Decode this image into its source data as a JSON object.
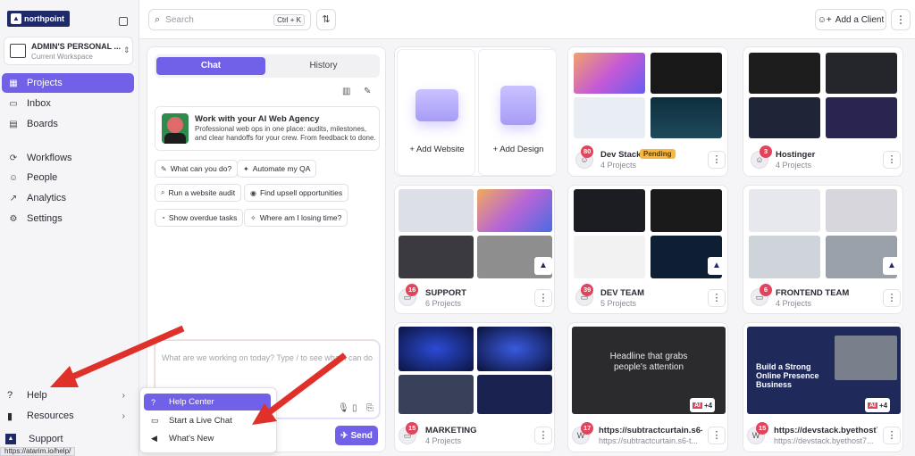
{
  "sidebar": {
    "logo_text": "northpoint",
    "workspace_name": "ADMIN'S PERSONAL ...",
    "workspace_sub": "Current Workspace",
    "nav": [
      {
        "label": "Projects",
        "icon": "grid-icon"
      },
      {
        "label": "Inbox",
        "icon": "inbox-icon"
      },
      {
        "label": "Boards",
        "icon": "board-icon"
      },
      {
        "label": "Workflows",
        "icon": "workflow-icon"
      },
      {
        "label": "People",
        "icon": "person-icon"
      },
      {
        "label": "Analytics",
        "icon": "chart-icon"
      },
      {
        "label": "Settings",
        "icon": "gear-icon"
      }
    ],
    "help_label": "Help",
    "resources_label": "Resources",
    "support_label": "Support",
    "status_url": "https://atarim.io/help/"
  },
  "topbar": {
    "search_placeholder": "Search",
    "search_shortcut": "Ctrl + K",
    "add_client_label": "Add a Client"
  },
  "chat": {
    "tabs": [
      "Chat",
      "History"
    ],
    "agency_title": "Work with your AI Web Agency",
    "agency_desc": "Professional web ops in one place: audits, milestones, and clear handoffs for your crew. From feedback to done.",
    "chips": [
      "What can you do?",
      "Automate my QA",
      "Run a website audit",
      "Find upsell opportunities",
      "Show overdue tasks",
      "Where am I losing time?"
    ],
    "composer_placeholder": "What are we working on today? Type / to see what I can do",
    "send_label": "Send"
  },
  "add_cards": {
    "website": "+ Add Website",
    "design": "+ Add Design"
  },
  "clients": [
    {
      "name": "Dev Stack",
      "sub": "4 Projects",
      "badge": "80",
      "tag": "Pending"
    },
    {
      "name": "Hostinger",
      "sub": "4 Projects",
      "badge": "3"
    },
    {
      "name": "SUPPORT",
      "sub": "6 Projects",
      "badge": "16"
    },
    {
      "name": "DEV TEAM",
      "sub": "5 Projects",
      "badge": "39"
    },
    {
      "name": "FRONTEND TEAM",
      "sub": "4 Projects",
      "badge": "6"
    },
    {
      "name": "MARKETING",
      "sub": "4 Projects",
      "badge": "15"
    },
    {
      "name": "https://subtractcurtain.s6-t...",
      "sub": "https://subtractcurtain.s6-t...",
      "badge": "17"
    },
    {
      "name": "https://devstack.byethost7...",
      "sub": "https://devstack.byethost7...",
      "badge": "15"
    }
  ],
  "thumb_text": {
    "headline": "Headline that grabs people's attention",
    "presence": "Build a Strong Online Presence Business",
    "plus_more": "+4"
  },
  "popup": {
    "items": [
      "Help Center",
      "Start a Live Chat",
      "What's New"
    ]
  },
  "colors": {
    "accent": "#7160e8",
    "badge": "#e2445c",
    "pending": "#f6b73c",
    "arrow": "#e0302a"
  }
}
